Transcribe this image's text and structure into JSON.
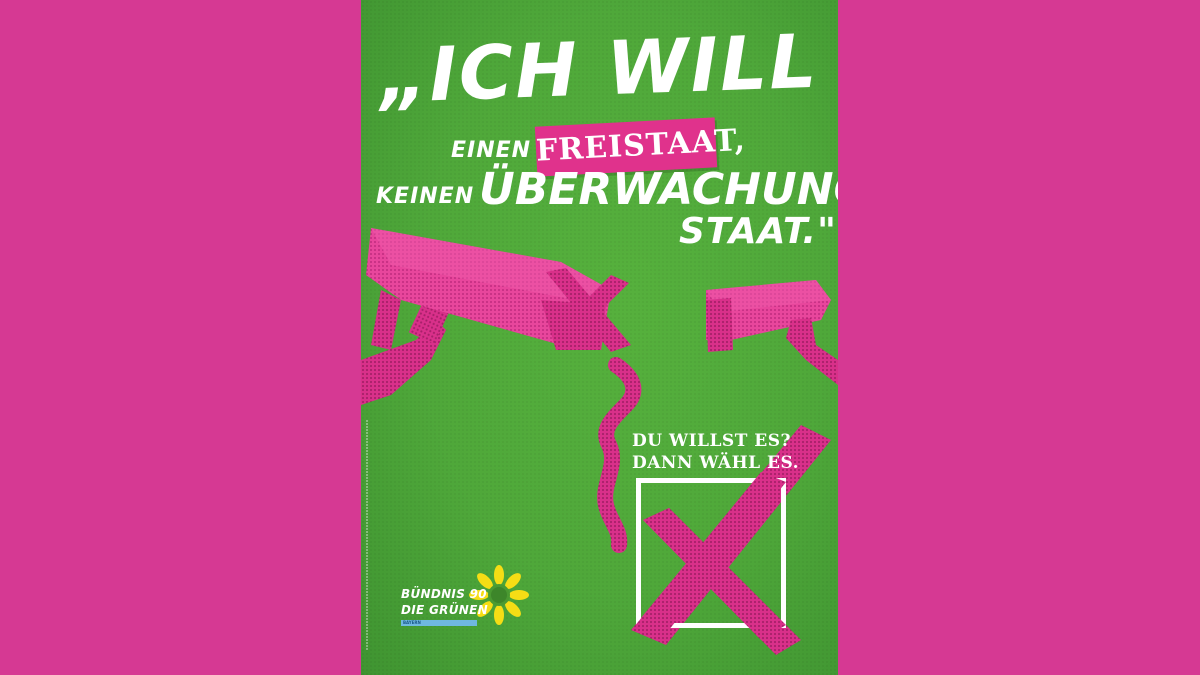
{
  "poster": {
    "headline": {
      "line1": "„ICH WILL",
      "line2_small": "EINEN",
      "line2_tag": "FREISTAAT,",
      "line3_small": "KEINEN",
      "line3_big": "ÜBERWACHUNGS-",
      "line4": "STAAT.\""
    },
    "slogan": {
      "line1": "DU WILLST ES?",
      "line2": "DANN WÄHL ES."
    },
    "logo": {
      "line1": "BÜNDNIS 90",
      "line2": "DIE GRÜNEN",
      "sub": "BAYERN"
    }
  },
  "colors": {
    "background": "#d63993",
    "poster_green": "#4fa83a",
    "accent_magenta": "#e0328c",
    "text": "#ffffff",
    "logo_yellow": "#f5dd15",
    "logo_blue": "#6fb8e0"
  },
  "icons": [
    "security-camera-icon",
    "security-camera-icon",
    "x-mark-icon",
    "ballot-box-icon",
    "sunflower-icon"
  ]
}
